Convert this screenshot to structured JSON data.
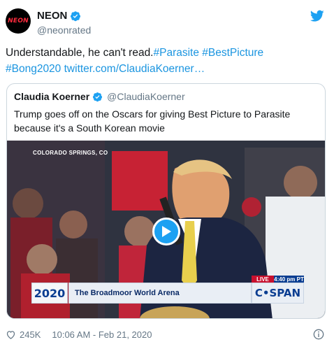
{
  "author": {
    "avatar_text": "NEON",
    "display_name": "NEON",
    "handle": "@neonrated",
    "verified_icon": "verified-badge-icon"
  },
  "tweet": {
    "text_plain": "Understandable, he can't read.",
    "hashtags": [
      "#Parasite",
      "#BestPicture",
      "#Bong2020"
    ],
    "link": "twitter.com/ClaudiaKoerner…"
  },
  "quoted": {
    "display_name": "Claudia Koerner",
    "handle": "@ClaudiaKoerner",
    "text": "Trump goes off on the Oscars for giving Best Picture to Parasite because it's a South Korean movie",
    "video": {
      "location_caption": "COLORADO SPRINGS, CO",
      "lower_third_logo": "2020",
      "lower_third_location": "The Broadmoor World Arena",
      "live_label": "LIVE",
      "time_label": "4:40 pm PT",
      "network": "C•SPAN"
    }
  },
  "footer": {
    "likes": "245K",
    "timestamp": "10:06 AM - Feb 21, 2020"
  },
  "colors": {
    "link": "#1b95e0",
    "verified": "#1da1f2",
    "muted": "#657786"
  }
}
